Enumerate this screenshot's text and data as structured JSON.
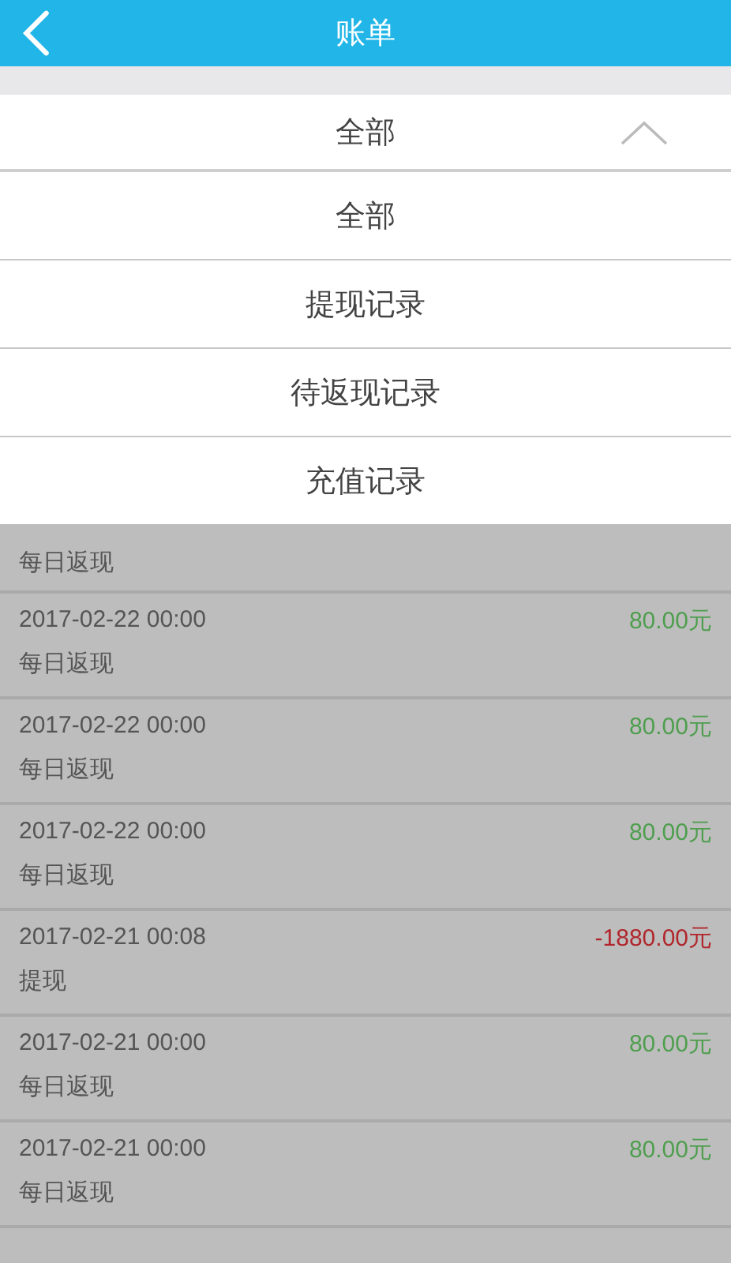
{
  "header": {
    "title": "账单"
  },
  "filter": {
    "value": "全部",
    "expanded": true
  },
  "menu": [
    "全部",
    "提现记录",
    "待返现记录",
    "充值记录"
  ],
  "partial_row": {
    "type": "每日返现"
  },
  "records": [
    {
      "date": "2017-02-22 00:00",
      "type": "每日返现",
      "amount": "80.00元",
      "kind": "income"
    },
    {
      "date": "2017-02-22 00:00",
      "type": "每日返现",
      "amount": "80.00元",
      "kind": "income"
    },
    {
      "date": "2017-02-22 00:00",
      "type": "每日返现",
      "amount": "80.00元",
      "kind": "income"
    },
    {
      "date": "2017-02-21 00:08",
      "type": "提现",
      "amount": "-1880.00元",
      "kind": "expense"
    },
    {
      "date": "2017-02-21 00:00",
      "type": "每日返现",
      "amount": "80.00元",
      "kind": "income"
    },
    {
      "date": "2017-02-21 00:00",
      "type": "每日返现",
      "amount": "80.00元",
      "kind": "income"
    }
  ]
}
